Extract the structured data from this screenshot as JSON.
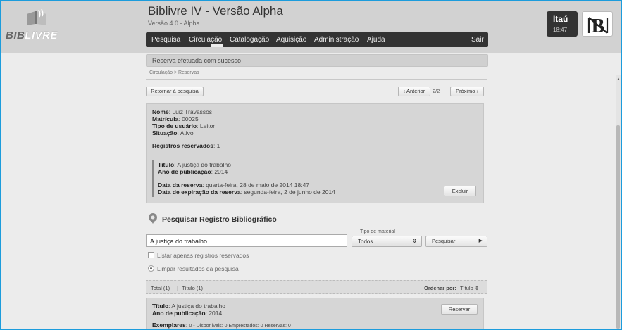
{
  "logo": {
    "text_part1": "BIB",
    "text_part2": "LIVRE"
  },
  "app": {
    "title": "Biblivre IV - Versão Alpha",
    "version": "Versão 4.0 - Alpha"
  },
  "nav": {
    "items": [
      "Pesquisa",
      "Circulação",
      "Catalogação",
      "Aquisição",
      "Administração",
      "Ajuda"
    ],
    "logout": "Sair",
    "active": "Circulação"
  },
  "badge": {
    "name": "Itaú",
    "time": "18:47"
  },
  "alert": {
    "message": "Reserva efetuada com sucesso"
  },
  "breadcrumb": "Circulação > Reservas",
  "toolbar": {
    "back_button": "Retornar à pesquisa",
    "prev_button": "‹ Anterior",
    "page_position": "2/2",
    "next_button": "Próximo ›"
  },
  "user": {
    "name_label": "Nome",
    "name": "Luiz Travassos",
    "registration_label": "Matrícula",
    "registration": "00025",
    "type_label": "Tipo de usuário",
    "type": "Leitor",
    "status_label": "Situação",
    "status": "Ativo",
    "reserved_label": "Registros reservados",
    "reserved_count": "1"
  },
  "reservation": {
    "title_label": "Título",
    "title": "A justiça do trabalho",
    "year_label": "Ano de publicação",
    "year": "2014",
    "date_label": "Data da reserva",
    "date": "quarta-feira, 28 de maio de 2014 18:47",
    "expiration_label": "Data de expiração da reserva",
    "expiration": "segunda-feira, 2 de junho de 2014",
    "delete_button": "Excluir"
  },
  "search": {
    "heading": "Pesquisar Registro Bibliográfico",
    "query": "A justiça do trabalho",
    "material_label": "Tipo de material",
    "material_value": "Todos",
    "search_button": "Pesquisar",
    "only_reserved_label": "Listar apenas registros reservados",
    "clear_label": "Limpar resultados da pesquisa"
  },
  "results": {
    "total_tab": "Total (1)",
    "separator": "|",
    "title_tab": "Título (1)",
    "sort_label": "Ordenar por:",
    "sort_value": "Título"
  },
  "result_item": {
    "title_label": "Título",
    "title": "A justiça do trabalho",
    "year_label": "Ano de publicação",
    "year": "2014",
    "copies_label": "Exemplares",
    "copies_summary": "0 - Disponíveis: 0  Emprestados: 0  Reservas: 0",
    "reserve_button": "Reservar"
  },
  "colors": {
    "frame": "#1c9cdc",
    "navbar": "#333333",
    "background": "#ececec"
  },
  "icons": [
    "book-icon",
    "monogram-icon",
    "location-pin-icon",
    "chevron-right-icon",
    "sort-arrows-icon"
  ]
}
